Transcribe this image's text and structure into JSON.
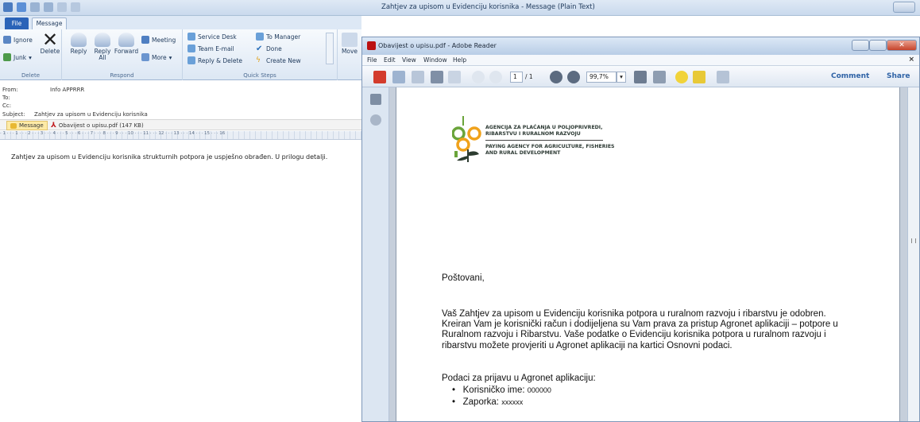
{
  "outlook": {
    "window_title": "Zahtjev za upisom u Evidenciju korisnika - Message (Plain Text)",
    "tabs": {
      "file": "File",
      "message": "Message"
    },
    "ribbon": {
      "delete_group": {
        "label": "Delete",
        "ignore": "Ignore",
        "junk": "Junk",
        "delete": "Delete"
      },
      "respond_group": {
        "label": "Respond",
        "reply": "Reply",
        "reply_all": "Reply All",
        "forward": "Forward",
        "meeting": "Meeting",
        "more": "More"
      },
      "quick_steps": {
        "label": "Quick Steps",
        "service_desk": "Service Desk",
        "team_email": "Team E-mail",
        "reply_delete": "Reply & Delete",
        "to_manager": "To Manager",
        "done": "Done",
        "create_new": "Create New"
      },
      "move": "Move"
    },
    "header": {
      "from_label": "From:",
      "from_value": "Info APPRRR",
      "to_label": "To:",
      "cc_label": "Cc:",
      "subject_label": "Subject:",
      "subject_value": "Zahtjev za upisom u Evidenciju korisnika"
    },
    "attachments": {
      "message_tab": "Message",
      "pdf": "Obavijest o upisu.pdf (147 KB)"
    },
    "ruler_text": "· 1 · · · 1 · · · 2 · · · 3 · · · 4 · · · 5 · · · 6 · · · 7 · · · 8 · · · 9 · · · 10 · · · 11 · · · 12 · · · 13 · · · 14 · · · 15 · · · 16",
    "body_text": "Zahtjev za upisom u Evidenciju korisnika strukturnih potpora je uspješno obrađen. U prilogu detalji."
  },
  "reader": {
    "window_title": "Obavijest o upisu.pdf - Adobe Reader",
    "menu": [
      "File",
      "Edit",
      "View",
      "Window",
      "Help"
    ],
    "toolbar": {
      "page_current": "1",
      "page_total": "/ 1",
      "zoom": "99,7%",
      "comment": "Comment",
      "share": "Share"
    },
    "page": {
      "logo_line1": "AGENCIJA ZA PLAĆANJA U POLJOPRIVREDI,",
      "logo_line2": "RIBARSTVU I RURALNOM RAZVOJU",
      "logo_line3": "PAYING AGENCY FOR AGRICULTURE, FISHERIES",
      "logo_line4": "AND RURAL DEVELOPMENT",
      "greeting": "Poštovani,",
      "paragraph": "Vaš Zahtjev za upisom u Evidenciju korisnika potpora u ruralnom razvoju i ribarstvu je odobren. Kreiran Vam je korisnički račun i dodijeljena su Vam prava za pristup Agronet aplikaciji – potpore u Ruralnom razvoju i Ribarstvu. Vaše podatke o Evidenciju korisnika potpora u ruralnom razvoju i ribarstvu možete provjeriti u Agronet aplikaciji na kartici Osnovni podaci.",
      "login_title": "Podaci za prijavu u Agronet aplikaciju:",
      "username_label": "Korisničko ime:",
      "username_value": "000000",
      "password_label": "Zaporka:",
      "password_value": "xxxxxx"
    }
  },
  "colors": {
    "outlook_file_tab": "#2a63b8",
    "reader_link": "#2f63a6",
    "logo_green": "#6aa43a",
    "logo_orange": "#f0a21b"
  }
}
